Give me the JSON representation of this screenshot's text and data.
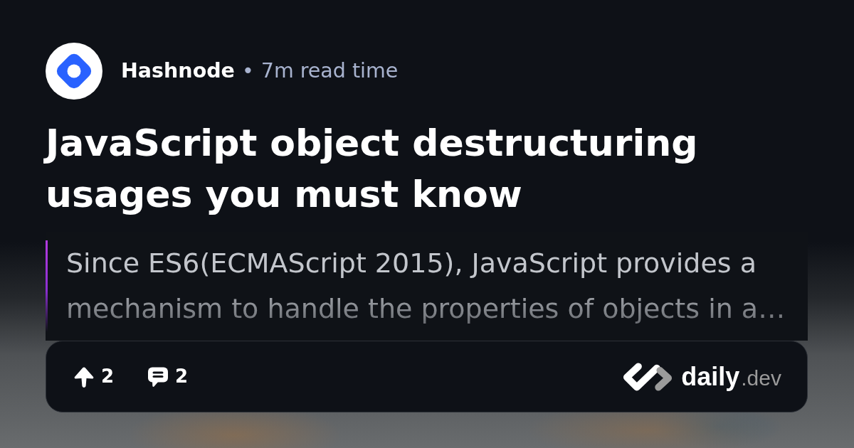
{
  "source": {
    "name": "Hashnode",
    "separator": "•",
    "read_time": "7m read time"
  },
  "title": "JavaScript object destructuring usages you must know",
  "description": "Since ES6(ECMAScript 2015), JavaScript provides a mechanism to handle the properties of objects in a…",
  "stats": [
    {
      "kind": "upvotes",
      "count": "2"
    },
    {
      "kind": "comments",
      "count": "2"
    }
  ],
  "brand": {
    "name": "daily",
    "suffix": ".dev"
  }
}
